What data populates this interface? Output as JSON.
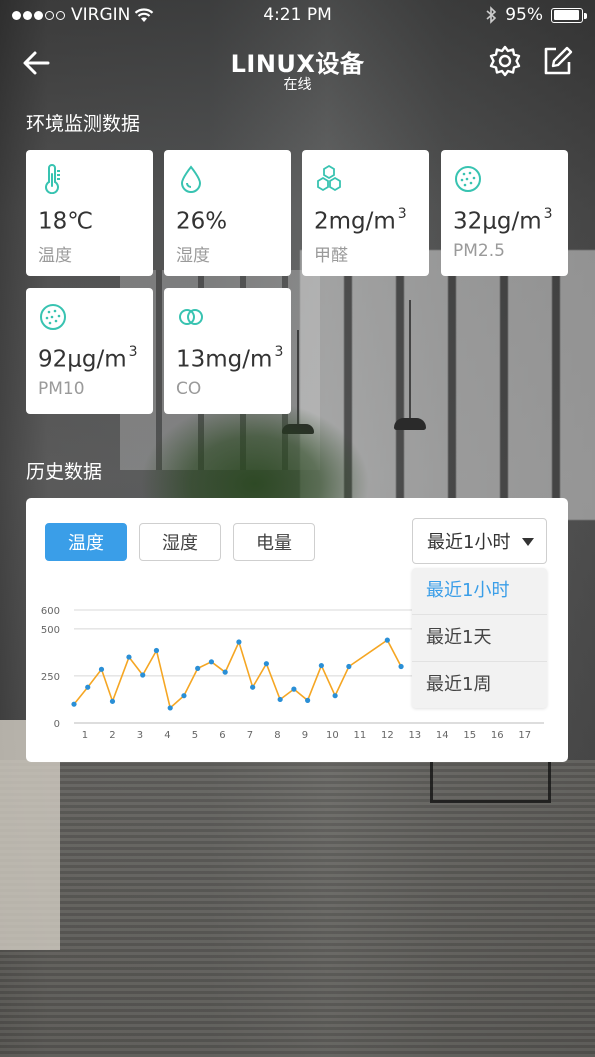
{
  "status_bar": {
    "carrier": "VIRGIN",
    "time": "4:21 PM",
    "battery": "95%",
    "battery_level": 0.95
  },
  "nav": {
    "title": "LINUX设备",
    "subtitle": "在线"
  },
  "sections": {
    "env": "环境监测数据",
    "history": "历史数据"
  },
  "metrics": [
    {
      "value": "18℃",
      "unit_sup": "",
      "label": "温度",
      "icon": "thermometer-icon"
    },
    {
      "value": "26%",
      "unit_sup": "",
      "label": "湿度",
      "icon": "droplet-icon"
    },
    {
      "value": "2mg/m",
      "unit_sup": "3",
      "label": "甲醛",
      "icon": "molecule-icon"
    },
    {
      "value": "32μg/m",
      "unit_sup": "3",
      "label": "PM2.5",
      "icon": "particle-icon"
    },
    {
      "value": "92μg/m",
      "unit_sup": "3",
      "label": "PM10",
      "icon": "particle-icon"
    },
    {
      "value": "13mg/m",
      "unit_sup": "3",
      "label": "CO",
      "icon": "co-icon"
    }
  ],
  "tabs": [
    {
      "label": "温度",
      "active": true
    },
    {
      "label": "湿度",
      "active": false
    },
    {
      "label": "电量",
      "active": false
    }
  ],
  "range_select": {
    "selected": "最近1小时",
    "options": [
      "最近1小时",
      "最近1天",
      "最近1周"
    ]
  },
  "colors": {
    "accent": "#3a9ee8",
    "line": "#f5a623",
    "point": "#2a8fd6"
  },
  "chart_data": {
    "type": "line",
    "x_ticks": [
      1,
      2,
      3,
      4,
      5,
      6,
      7,
      8,
      9,
      10,
      11,
      12,
      13,
      14,
      15,
      16,
      17
    ],
    "y_ticks": [
      0,
      250,
      500,
      600
    ],
    "ylim": [
      0,
      600
    ],
    "xlim": [
      0.6,
      17.7
    ],
    "x": [
      0.6,
      1.1,
      1.6,
      2.0,
      2.6,
      3.1,
      3.6,
      4.1,
      4.6,
      5.1,
      5.6,
      6.1,
      6.6,
      7.1,
      7.6,
      8.1,
      8.6,
      9.1,
      9.6,
      10.1,
      10.6,
      12.0,
      12.5
    ],
    "values": [
      100,
      190,
      285,
      115,
      350,
      255,
      385,
      80,
      145,
      290,
      325,
      270,
      430,
      190,
      315,
      125,
      180,
      120,
      305,
      145,
      300,
      440,
      300
    ]
  }
}
